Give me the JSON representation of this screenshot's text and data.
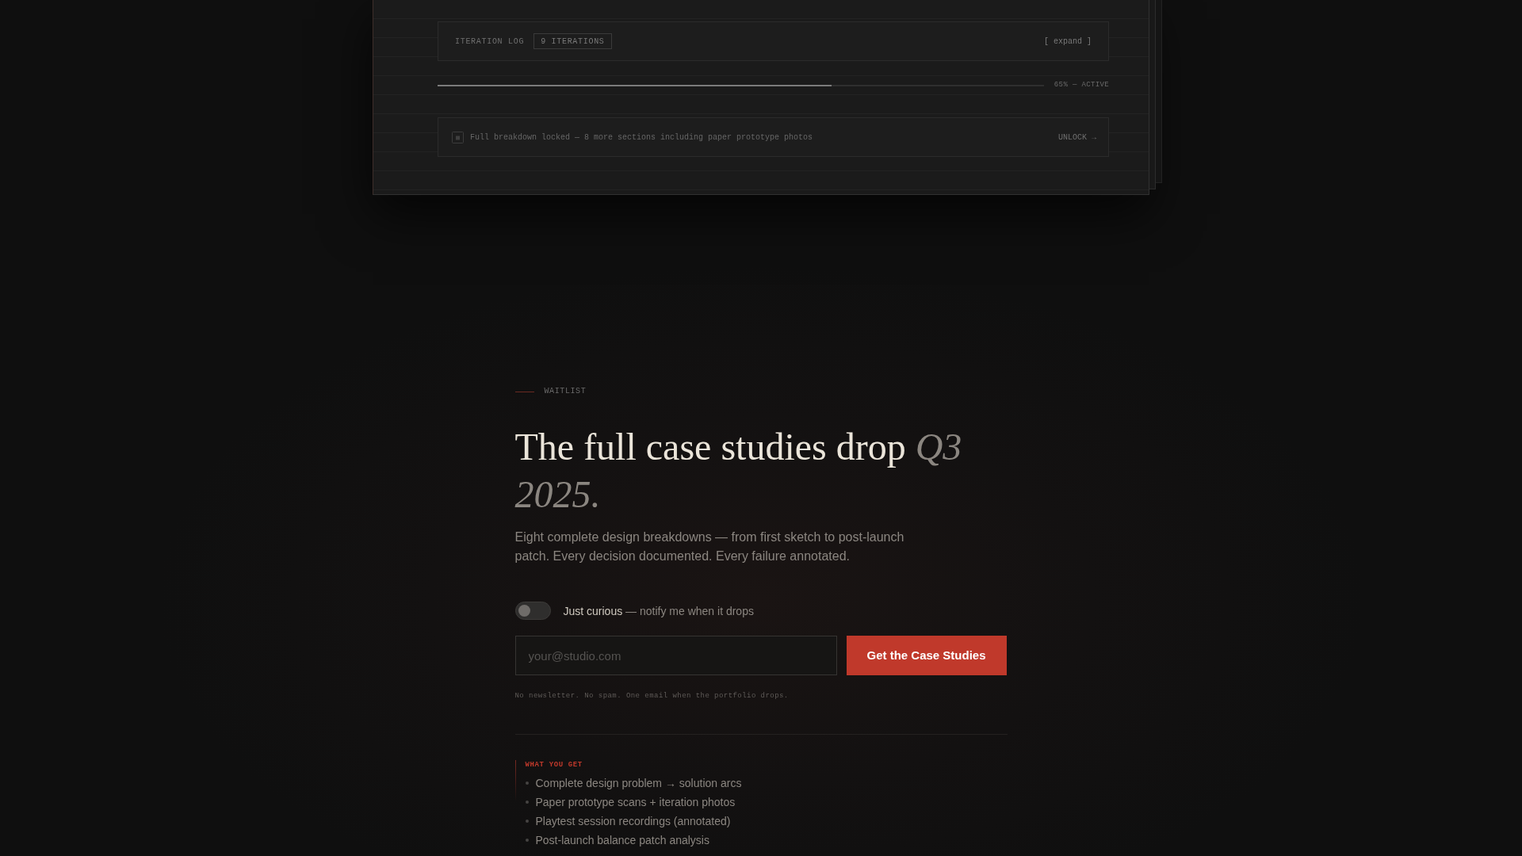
{
  "preview_card": {
    "iteration_log": {
      "label": "ITERATION LOG",
      "badge": "9 ITERATIONS",
      "action": "[ expand ]"
    },
    "progress": {
      "level": 0.65,
      "reading": "65% — ACTIVE"
    },
    "locked_notice": {
      "text": "Full breakdown locked — 8 more sections including paper prototype photos",
      "action": "UNLOCK →"
    }
  },
  "waitlist": {
    "eyebrow": "WAITLIST",
    "heading": "The full case studies drop *Q3 2025.*",
    "description": "Eight complete design breakdowns — from first sketch to post-launch patch. Every decision documented. Every failure annotated.",
    "toggle": {
      "on": false,
      "label": "Just curious",
      "hint": "— notify me when it drops"
    },
    "email": {
      "placeholder": "your@studio.com"
    },
    "submit": "Get the Case Studies",
    "note": "No newsletter. No spam. One email when the portfolio drops."
  },
  "benefits": {
    "title": "WHAT YOU GET",
    "items": [
      "Complete design problem → solution arcs",
      "Paper prototype scans + iteration photos",
      "Playtest session recordings (annotated)",
      "Post-launch balance patch analysis"
    ]
  }
}
